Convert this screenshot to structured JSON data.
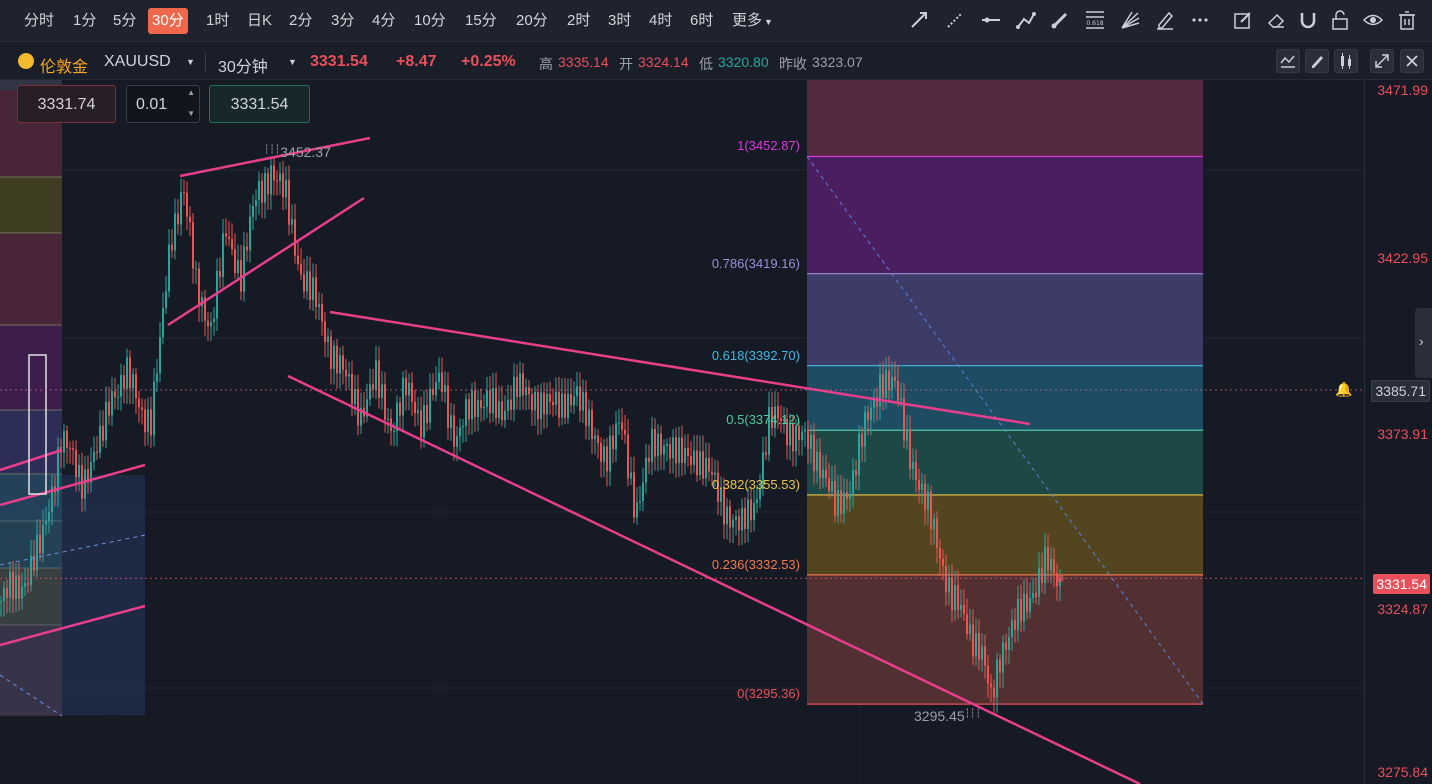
{
  "toolbar": {
    "timeframes": [
      "分时",
      "1分",
      "5分",
      "30分",
      "1时",
      "日K",
      "2分",
      "3分",
      "4分",
      "10分",
      "15分",
      "20分",
      "2时",
      "3时",
      "4时",
      "6时",
      "更多"
    ],
    "active_timeframe": "30分",
    "drawing_tools": [
      "trend-line-icon",
      "ray-line-icon",
      "horizontal-line-icon",
      "polyline-icon",
      "brush-icon",
      "fibonacci-icon",
      "fan-icon",
      "pen-icon",
      "more-icon"
    ],
    "right_tools": [
      "edit-icon",
      "eraser-icon",
      "magnet-icon",
      "lock-icon",
      "eye-icon",
      "trash-icon"
    ]
  },
  "symbol": {
    "name": "伦敦金",
    "code": "XAUUSD",
    "period": "30分钟",
    "price": "3331.54",
    "change": "+8.47",
    "change_pct": "+0.25%",
    "high_label": "高",
    "high": "3335.14",
    "open_label": "开",
    "open": "3324.14",
    "low_label": "低",
    "low": "3320.80",
    "prev_close_label": "昨收",
    "prev_close": "3323.07"
  },
  "order": {
    "sell_price": "3331.74",
    "quantity": "0.01",
    "buy_price": "3331.54"
  },
  "y_axis": {
    "labels": [
      "3471.99",
      "3422.95",
      "3373.91",
      "3324.87",
      "3275.84"
    ],
    "current_price": "3331.54",
    "alert_price": "3385.71"
  },
  "fibonacci": {
    "levels": [
      {
        "label": "1(3452.87)",
        "ratio": 1,
        "price": 3452.87,
        "color": "#d63ad6"
      },
      {
        "label": "0.786(3419.16)",
        "ratio": 0.786,
        "price": 3419.16,
        "color": "#9c8fd6"
      },
      {
        "label": "0.618(3392.70)",
        "ratio": 0.618,
        "price": 3392.7,
        "color": "#3fb9e0"
      },
      {
        "label": "0.5(3374.12)",
        "ratio": 0.5,
        "price": 3374.12,
        "color": "#4dc9a0"
      },
      {
        "label": "0.382(3355.53)",
        "ratio": 0.382,
        "price": 3355.53,
        "color": "#e8c547"
      },
      {
        "label": "0.236(3332.53)",
        "ratio": 0.236,
        "price": 3332.53,
        "color": "#f07a4a"
      },
      {
        "label": "0(3295.36)",
        "ratio": 0,
        "price": 3295.36,
        "color": "#e8505b"
      }
    ]
  },
  "annotations": {
    "high_mark": "3452.37",
    "low_mark": "3295.45"
  },
  "colors": {
    "up": "#26a69a",
    "down": "#ef5350",
    "accent": "#f0684b",
    "trendline": "#e83e8c"
  }
}
